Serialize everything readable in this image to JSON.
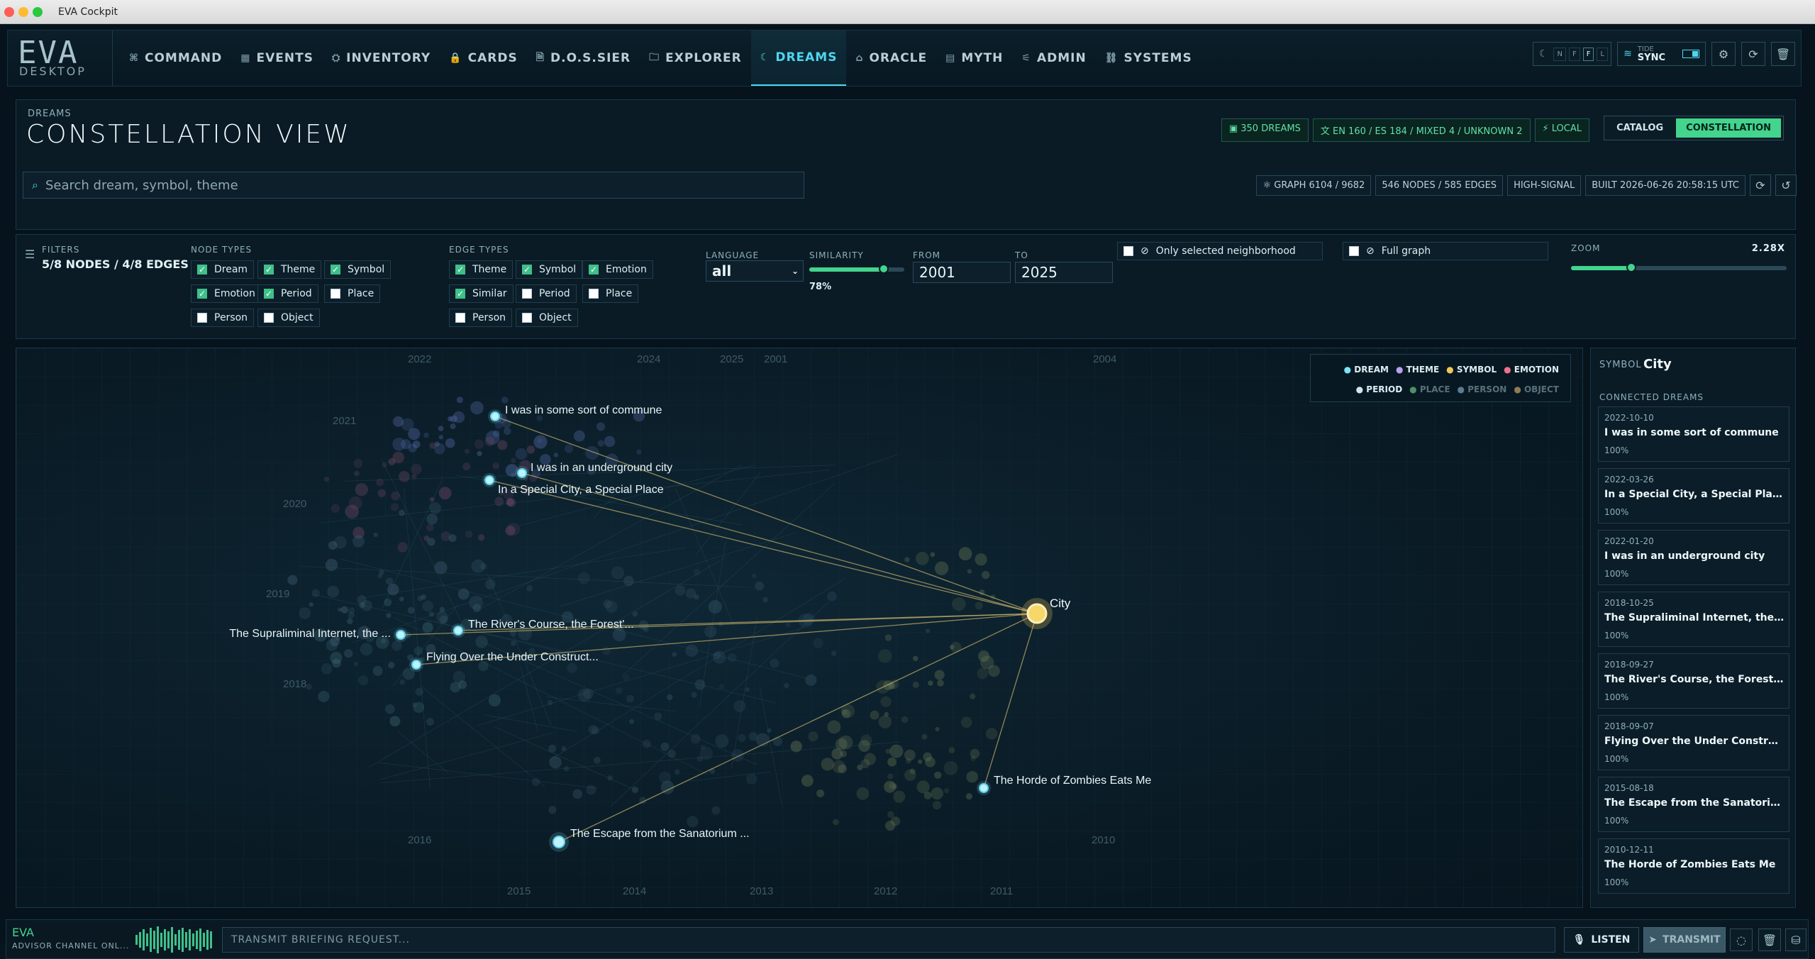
{
  "window": {
    "title": "EVA Cockpit"
  },
  "logo": {
    "main": "EVA",
    "sub": "DESKTOP"
  },
  "nav": {
    "tabs": [
      {
        "label": "COMMAND",
        "icon": "command-icon"
      },
      {
        "label": "EVENTS",
        "icon": "calendar-icon"
      },
      {
        "label": "INVENTORY",
        "icon": "inventory-icon"
      },
      {
        "label": "CARDS",
        "icon": "lock-icon"
      },
      {
        "label": "D.O.S.SIER",
        "icon": "file-icon"
      },
      {
        "label": "EXPLORER",
        "icon": "folder-icon"
      },
      {
        "label": "DREAMS",
        "icon": "moon-icon"
      },
      {
        "label": "ORACLE",
        "icon": "oracle-icon"
      },
      {
        "label": "MYTH",
        "icon": "book-icon"
      },
      {
        "label": "ADMIN",
        "icon": "admin-icon"
      },
      {
        "label": "SYSTEMS",
        "icon": "systems-icon"
      }
    ],
    "active": "DREAMS"
  },
  "mode_segments": [
    "N",
    "F",
    "F",
    "L"
  ],
  "sync": {
    "label": "TIDE",
    "value": "SYNC"
  },
  "header": {
    "section": "DREAMS",
    "title": "CONSTELLATION VIEW",
    "badges": [
      "350 DREAMS",
      "EN 160 / ES 184 / MIXED 4 / UNKNOWN 2",
      "LOCAL"
    ],
    "views": [
      "CATALOG",
      "CONSTELLATION"
    ],
    "active_view": "CONSTELLATION"
  },
  "search": {
    "placeholder": "Search dream, symbol, theme"
  },
  "stats": [
    "GRAPH 6104 / 9682",
    "546 NODES / 585 EDGES",
    "HIGH-SIGNAL",
    "BUILT 2026-06-26 20:58:15 UTC"
  ],
  "filters": {
    "label": "FILTERS",
    "summary": "5/8 NODES / 4/8 EDGES",
    "node_types_label": "NODE TYPES",
    "node_types": [
      {
        "label": "Dream",
        "checked": true
      },
      {
        "label": "Theme",
        "checked": true
      },
      {
        "label": "Symbol",
        "checked": true
      },
      {
        "label": "Emotion",
        "checked": true
      },
      {
        "label": "Period",
        "checked": true
      },
      {
        "label": "Place",
        "checked": false
      },
      {
        "label": "Person",
        "checked": false
      },
      {
        "label": "Object",
        "checked": false
      }
    ],
    "edge_types_label": "EDGE TYPES",
    "edge_types": [
      {
        "label": "Theme",
        "checked": true
      },
      {
        "label": "Symbol",
        "checked": true
      },
      {
        "label": "Emotion",
        "checked": true
      },
      {
        "label": "Similar",
        "checked": true
      },
      {
        "label": "Period",
        "checked": false
      },
      {
        "label": "Place",
        "checked": false
      },
      {
        "label": "Person",
        "checked": false
      },
      {
        "label": "Object",
        "checked": false
      }
    ],
    "language_label": "LANGUAGE",
    "language": "all",
    "similarity_label": "SIMILARITY",
    "similarity": "78%",
    "similarity_value": 0.78,
    "from_label": "FROM",
    "from": "2001",
    "to_label": "TO",
    "to": "2025",
    "only_neighborhood": "Only selected neighborhood",
    "full_graph": "Full graph",
    "zoom_label": "ZOOM",
    "zoom": "2.28X",
    "zoom_value": 0.28
  },
  "legend": {
    "row1": [
      "DREAM",
      "THEME",
      "SYMBOL",
      "EMOTION"
    ],
    "row2": [
      "PERIOD",
      "PLACE",
      "PERSON",
      "OBJECT"
    ]
  },
  "graph": {
    "year_labels": [
      "2022",
      "2024",
      "2025",
      "2001",
      "2004",
      "2021",
      "2020",
      "2019",
      "2018",
      "2016",
      "2015",
      "2014",
      "2013",
      "2012",
      "2011",
      "2010"
    ],
    "center": {
      "label": "City"
    },
    "dreams": [
      {
        "label": "I was in some sort of commune"
      },
      {
        "label": "I was in an underground city"
      },
      {
        "label": "In a Special City, a Special Place"
      },
      {
        "label": "The Supraliminal Internet, the ..."
      },
      {
        "label": "The River's Course, the Forest'..."
      },
      {
        "label": "Flying Over the Under Construct..."
      },
      {
        "label": "The Horde of Zombies Eats Me"
      },
      {
        "label": "The Escape from the Sanatorium ..."
      }
    ]
  },
  "sidebar": {
    "kind": "SYMBOL",
    "name": "City",
    "section": "CONNECTED DREAMS",
    "items": [
      {
        "date": "2022-10-10",
        "title": "I was in some sort of commune",
        "pct": "100%"
      },
      {
        "date": "2022-03-26",
        "title": "In a Special City, a Special Place",
        "pct": "100%"
      },
      {
        "date": "2022-01-20",
        "title": "I was in an underground city",
        "pct": "100%"
      },
      {
        "date": "2018-10-25",
        "title": "The Supraliminal Internet, the Au...",
        "pct": "100%"
      },
      {
        "date": "2018-09-27",
        "title": "The River's Course, the Forest's F...",
        "pct": "100%"
      },
      {
        "date": "2018-09-07",
        "title": "Flying Over the Under Constructi...",
        "pct": "100%"
      },
      {
        "date": "2015-08-18",
        "title": "The Escape from the Sanatorium ...",
        "pct": "100%"
      },
      {
        "date": "2010-12-11",
        "title": "The Horde of Zombies Eats Me",
        "pct": "100%"
      }
    ]
  },
  "bottom": {
    "name": "EVA",
    "channel": "ADVISOR CHANNEL ONL...",
    "placeholder": "TRANSMIT BRIEFING REQUEST...",
    "listen": "LISTEN",
    "transmit": "TRANSMIT"
  }
}
